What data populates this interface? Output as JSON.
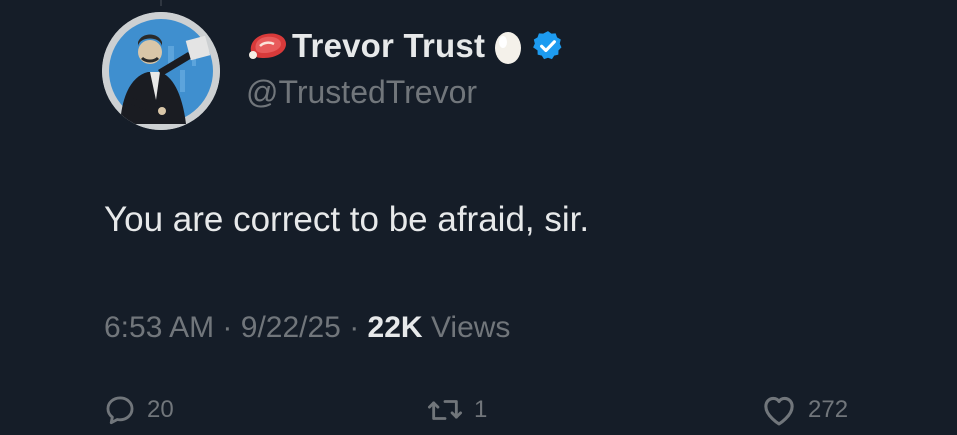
{
  "tweet": {
    "display_name": "Trevor Trust",
    "handle": "@TrustedTrevor",
    "text": "You are correct to be afraid, sir.",
    "time": "6:53 AM",
    "date": "9/22/25",
    "separator": "·",
    "views_count": "22K",
    "views_label": "Views",
    "emoji_before_name": "steak-icon",
    "emoji_after_name": "egg-icon",
    "badge": "verified-badge-icon",
    "badge_color": "#1d9bf0"
  },
  "actions": {
    "replies": "20",
    "reposts": "1",
    "likes": "272"
  },
  "colors": {
    "background": "#151d28",
    "primary_text": "#e7e9ea",
    "secondary_text": "#71767b"
  }
}
